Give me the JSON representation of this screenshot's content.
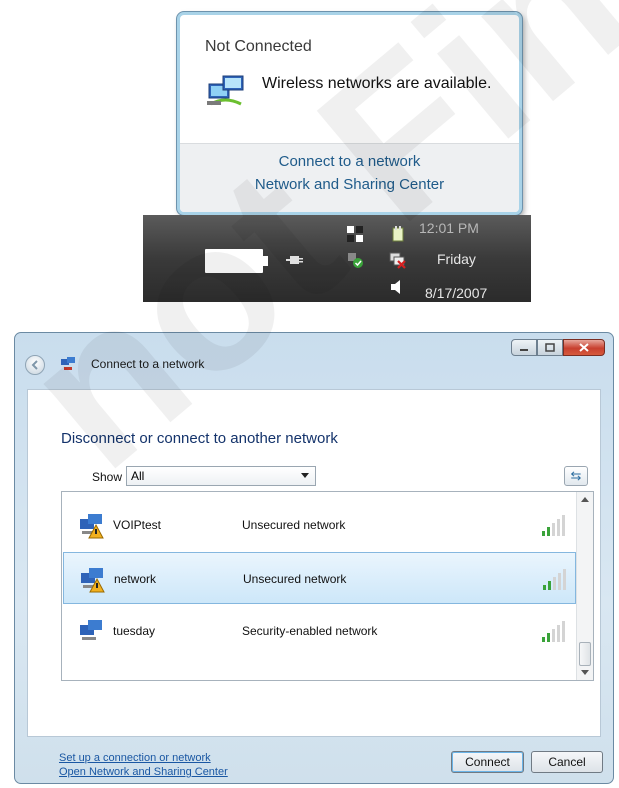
{
  "popup": {
    "title": "Not Connected",
    "message": "Wireless networks are available.",
    "link_connect": "Connect to a network",
    "link_center": "Network and Sharing Center",
    "icon": "network-computers-icon"
  },
  "taskbar": {
    "time": "12:01 PM",
    "day": "Friday",
    "date": "8/17/2007",
    "icons": [
      "battery-icon",
      "power-plug-icon",
      "network-icon",
      "security-shield-icon",
      "wireless-icon",
      "network-error-icon",
      "speaker-icon"
    ]
  },
  "dialog": {
    "title": "Connect to a network",
    "heading": "Disconnect or connect to another network",
    "show_label": "Show",
    "show_value": "All",
    "networks": [
      {
        "ssid": "VOIPtest",
        "status": "Unsecured network",
        "selected": false
      },
      {
        "ssid": "network",
        "status": "Unsecured network",
        "selected": true
      },
      {
        "ssid": "tuesday",
        "status": "Security-enabled network",
        "selected": false
      }
    ],
    "link_setup": "Set up a connection or network",
    "link_center": "Open Network and Sharing Center",
    "connect_label": "Connect",
    "cancel_label": "Cancel"
  },
  "watermark": "not Final"
}
